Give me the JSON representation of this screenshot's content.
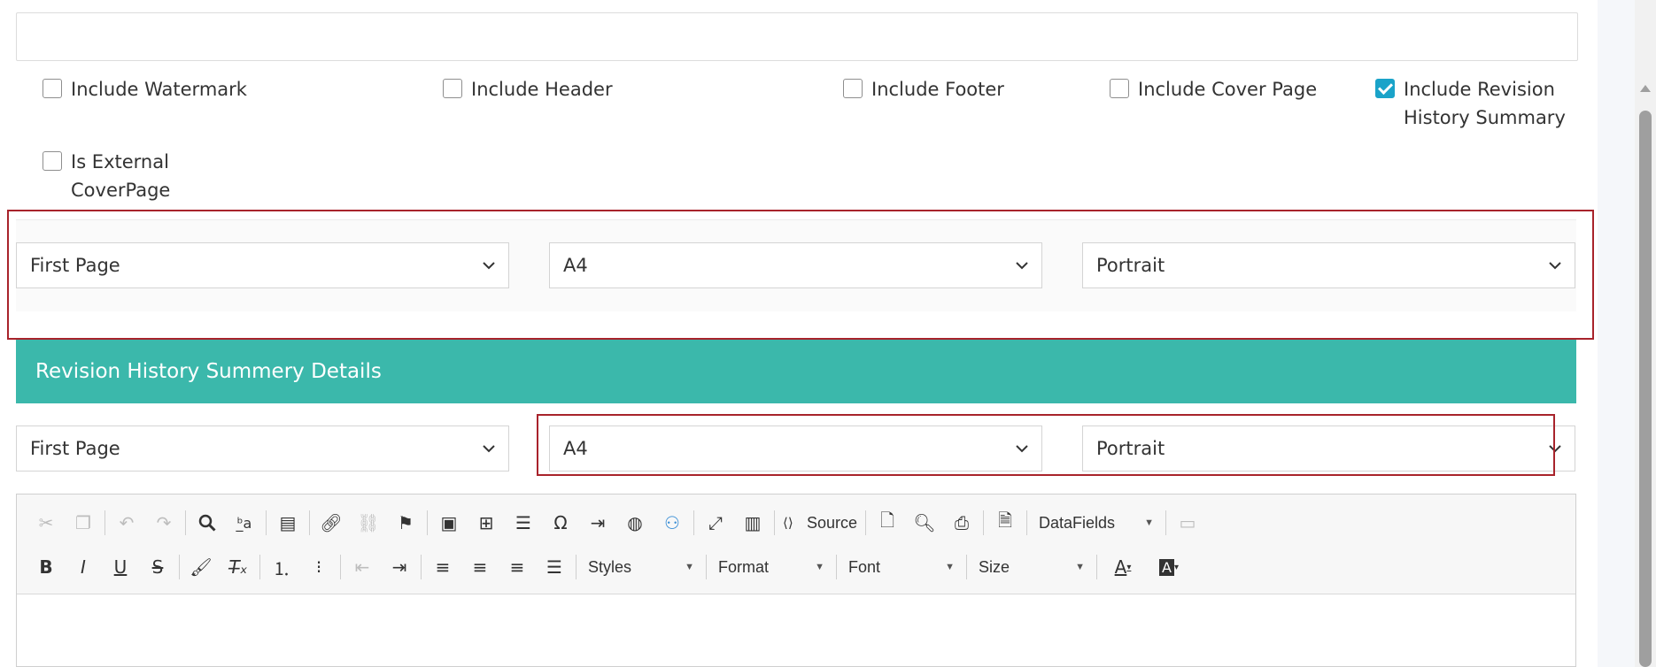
{
  "checkboxes": [
    {
      "label": "Include Watermark",
      "checked": false
    },
    {
      "label": "Include Header",
      "checked": false
    },
    {
      "label": "Include Footer",
      "checked": false
    },
    {
      "label": "Include Cover Page",
      "checked": false
    },
    {
      "label": "Include Revision History Summary",
      "checked": true
    },
    {
      "label": "Is External CoverPage",
      "checked": false
    }
  ],
  "top_selects": {
    "page": "First Page",
    "size": "A4",
    "orientation": "Portrait"
  },
  "section": {
    "title": "Revision History Summery Details"
  },
  "section_selects": {
    "page": "First Page",
    "size": "A4",
    "orientation": "Portrait"
  },
  "editor": {
    "source_label": "Source",
    "datafields_label": "DataFields",
    "styles_label": "Styles",
    "format_label": "Format",
    "font_label": "Font",
    "size_label": "Size"
  },
  "colors": {
    "accent": "#3bb8ab",
    "highlight_border": "#a8232b",
    "checkbox_checked": "#1aa3c9"
  }
}
